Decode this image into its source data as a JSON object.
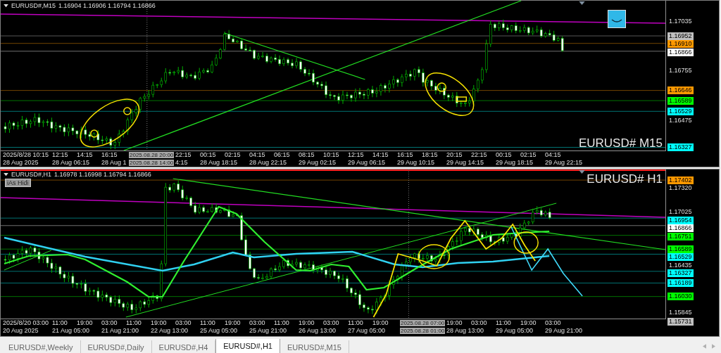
{
  "panes": [
    {
      "title": "EURUSD#,M15",
      "quotes": "1.16904 1.16906 1.16794 1.16866",
      "symbol_label": "EURUSD# M15",
      "price_labels": [
        {
          "price": "1.17035"
        },
        {
          "price": "1.16952",
          "color": "#c0c0c0"
        },
        {
          "price": "1.16910",
          "color": "#ff9900"
        },
        {
          "price": "1.16866",
          "color": "#ffffff"
        },
        {
          "price": "1.16755"
        },
        {
          "price": "1.16646",
          "color": "#ff9900"
        },
        {
          "price": "1.16589",
          "color": "#00ff00"
        },
        {
          "price": "1.16529",
          "color": "#00ffff"
        },
        {
          "price": "1.16475"
        },
        {
          "price": "1.16327",
          "color": "#00ffff"
        }
      ],
      "time_axis": [
        [
          {
            "text": "2025/8/28 10:15",
            "kind": "start"
          },
          {
            "text": "12:15",
            "kind": "tick"
          },
          {
            "text": "14:15",
            "kind": "tick"
          },
          {
            "text": "16:15",
            "kind": "tick"
          },
          {
            "text": "2025.08.28 20:00",
            "kind": "cursor"
          },
          {
            "text": "22:15",
            "kind": "tick"
          },
          {
            "text": "00:15",
            "kind": "tick"
          },
          {
            "text": "02:15",
            "kind": "tick"
          },
          {
            "text": "04:15",
            "kind": "tick"
          },
          {
            "text": "06:15",
            "kind": "tick"
          },
          {
            "text": "08:15",
            "kind": "tick"
          },
          {
            "text": "10:15",
            "kind": "tick"
          },
          {
            "text": "12:15",
            "kind": "tick"
          },
          {
            "text": "14:15",
            "kind": "tick"
          },
          {
            "text": "16:15",
            "kind": "tick"
          },
          {
            "text": "18:15",
            "kind": "tick"
          },
          {
            "text": "20:15",
            "kind": "tick"
          },
          {
            "text": "22:15",
            "kind": "tick"
          },
          {
            "text": "00:15",
            "kind": "tick"
          },
          {
            "text": "02:15",
            "kind": "tick"
          },
          {
            "text": "04:15",
            "kind": "tick"
          }
        ],
        [
          {
            "text": "28 Aug 2025",
            "kind": "tick"
          },
          {
            "text": "28 Aug 06:15",
            "kind": "tick"
          },
          {
            "text": "28 Aug 1",
            "kind": "cut"
          },
          {
            "text": "2025.08.28 14:00",
            "kind": "cursor"
          },
          {
            "text": "4:15",
            "kind": "cut"
          },
          {
            "text": "28 Aug 18:15",
            "kind": "tick"
          },
          {
            "text": "28 Aug 22:15",
            "kind": "tick"
          },
          {
            "text": "29 Aug 02:15",
            "kind": "tick"
          },
          {
            "text": "29 Aug 06:15",
            "kind": "tick"
          },
          {
            "text": "29 Aug 10:15",
            "kind": "tick"
          },
          {
            "text": "29 Aug 14:15",
            "kind": "tick"
          },
          {
            "text": "29 Aug 18:15",
            "kind": "tick"
          },
          {
            "text": "29 Aug 22:15",
            "kind": "tick"
          }
        ]
      ]
    },
    {
      "title": "EURUSD#,H1",
      "quotes": "1.16978 1.16998 1.16794 1.16866",
      "symbol_label": "EURUSD# H1",
      "indicator_button": "iAs Hidi",
      "price_labels": [
        {
          "price": "1.17402",
          "color": "#ff9900"
        },
        {
          "price": "1.17320"
        },
        {
          "price": "1.17025"
        },
        {
          "price": "1.16954",
          "color": "#00ffff"
        },
        {
          "price": "1.16866",
          "color": "#ffffff"
        },
        {
          "price": "1.16751",
          "color": "#00ff00"
        },
        {
          "price": "1.16589",
          "color": "#00ff00"
        },
        {
          "price": "1.16529",
          "color": "#00ffff"
        },
        {
          "price": "1.16435"
        },
        {
          "price": "1.16327",
          "color": "#00ffff"
        },
        {
          "price": "1.16189",
          "color": "#00ffff"
        },
        {
          "price": "1.16030",
          "color": "#00ff00"
        },
        {
          "price": "1.15845"
        },
        {
          "price": "1.15731",
          "color": "#c0c0c0"
        }
      ],
      "time_axis": [
        [
          {
            "text": "2025/8/20 03:00",
            "kind": "start"
          },
          {
            "text": "11:00",
            "kind": "tick"
          },
          {
            "text": "19:00",
            "kind": "tick"
          },
          {
            "text": "03:00",
            "kind": "tick"
          },
          {
            "text": "11:00",
            "kind": "tick"
          },
          {
            "text": "19:00",
            "kind": "tick"
          },
          {
            "text": "03:00",
            "kind": "tick"
          },
          {
            "text": "11:00",
            "kind": "tick"
          },
          {
            "text": "19:00",
            "kind": "tick"
          },
          {
            "text": "03:00",
            "kind": "tick"
          },
          {
            "text": "11:00",
            "kind": "tick"
          },
          {
            "text": "19:00",
            "kind": "tick"
          },
          {
            "text": "03:00",
            "kind": "tick"
          },
          {
            "text": "11:00",
            "kind": "tick"
          },
          {
            "text": "19:00",
            "kind": "tick"
          },
          {
            "text": "2025.08.28 07:00",
            "kind": "cursor"
          },
          {
            "text": "19:00",
            "kind": "tick"
          },
          {
            "text": "03:00",
            "kind": "tick"
          },
          {
            "text": "11:00",
            "kind": "tick"
          },
          {
            "text": "19:00",
            "kind": "tick"
          },
          {
            "text": "03:00",
            "kind": "tick"
          }
        ],
        [
          {
            "text": "20 Aug 2025",
            "kind": "tick"
          },
          {
            "text": "21 Aug 05:00",
            "kind": "tick"
          },
          {
            "text": "21 Aug 21:00",
            "kind": "tick"
          },
          {
            "text": "22 Aug 13:00",
            "kind": "tick"
          },
          {
            "text": "25 Aug 05:00",
            "kind": "tick"
          },
          {
            "text": "25 Aug 21:00",
            "kind": "tick"
          },
          {
            "text": "26 Aug 13:00",
            "kind": "tick"
          },
          {
            "text": "27 Aug 05:00",
            "kind": "tick"
          },
          {
            "text": "2025.08.28 01:00",
            "kind": "cursor"
          },
          {
            "text": "28 Aug 13:00",
            "kind": "tick"
          },
          {
            "text": "29 Aug 05:00",
            "kind": "tick"
          },
          {
            "text": "29 Aug 21:00",
            "kind": "tick"
          }
        ]
      ]
    }
  ],
  "tabs": [
    {
      "label": "EURUSD#,Weekly",
      "selected": false
    },
    {
      "label": "EURUSD#,Daily",
      "selected": false
    },
    {
      "label": "EURUSD#,H4",
      "selected": false
    },
    {
      "label": "EURUSD#,H1",
      "selected": true
    },
    {
      "label": "EURUSD#,M15",
      "selected": false
    }
  ]
}
